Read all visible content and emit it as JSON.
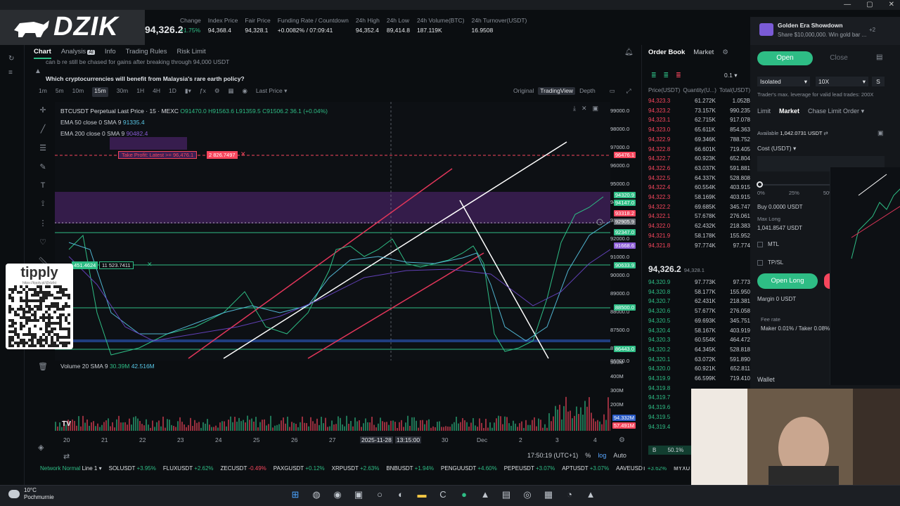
{
  "window": {
    "controls": [
      "—",
      "▢",
      "✕"
    ]
  },
  "logo": {
    "text": "DZIK"
  },
  "header": {
    "last_price": "94,326.2",
    "stats": [
      {
        "k": "Change",
        "v": "+1.75%",
        "green": true
      },
      {
        "k": "Index Price",
        "v": "94,368.4"
      },
      {
        "k": "Fair Price",
        "v": "94,328.1"
      },
      {
        "k": "Funding Rate / Countdown",
        "v": "+0.0082% / 07:09:41"
      },
      {
        "k": "24h High",
        "v": "94,352.4"
      },
      {
        "k": "24h Low",
        "v": "89,414.8"
      },
      {
        "k": "24h Volume(BTC)",
        "v": "187.119K"
      },
      {
        "k": "24h Turnover(USDT)",
        "v": "16.9508"
      }
    ]
  },
  "tabs": {
    "chart": "Chart",
    "analysis": "Analysis",
    "ai": "AI",
    "info": "Info",
    "trading_rules": "Trading Rules",
    "risk_limit": "Risk Limit"
  },
  "news": {
    "line1": "can b re still be chased for gains after breaking through 94,000 USDT",
    "line2": "Which cryptocurrencies will benefit from Malaysia's rare earth policy?"
  },
  "toolbar": {
    "intervals": [
      "1m",
      "5m",
      "10m",
      "15m",
      "30m",
      "1H",
      "4H",
      "1D"
    ],
    "selected": "15m",
    "last_price": "Last Price",
    "views": [
      "Original",
      "TradingView",
      "Depth"
    ],
    "view_selected": "TradingView"
  },
  "legend": {
    "title": "BTCUSDT Perpetual Last Price · 15 · MEXC",
    "ohlc": "O91470.0 H91563.6 L91359.5 C91506.2 36.1 (+0.04%)",
    "ema50": "EMA 50 close 0 SMA 9",
    "ema50_v": "91335.4",
    "ema200": "EMA 200 close 0 SMA 9",
    "ema200_v": "90482.4",
    "volume": "Volume 20 SMA 9",
    "vol1": "30.39M",
    "vol2": "42.516M"
  },
  "orders": {
    "tp": "Take Profit: Latest >= 96,476.1",
    "tp_qty": "2 826.7497",
    "entry": "451.4624",
    "entry_qty": "11 523.7411"
  },
  "price_axis": {
    "ticks": [
      "99000.0",
      "98000.0",
      "97000.0",
      "96000.0",
      "95000.0",
      "94000.0",
      "93000.0",
      "92000.0",
      "91000.0",
      "90000.0",
      "89000.0",
      "88000.0",
      "87500.0",
      "87000.0",
      "86000.0"
    ],
    "labels": [
      {
        "v": "96476.1",
        "c": "#f6465d"
      },
      {
        "v": "94320.9",
        "c": "#2ebd85"
      },
      {
        "v": "94147.0",
        "c": "#2ebd85"
      },
      {
        "v": "93318.2",
        "c": "#f6465d"
      },
      {
        "v": "92905.9",
        "c": "#6b6f76"
      },
      {
        "v": "92347.0",
        "c": "#2ebd85"
      },
      {
        "v": "91668.6",
        "c": "#8a5bd6"
      },
      {
        "v": "90633.9",
        "c": "#2ebd85"
      },
      {
        "v": "88500.0",
        "c": "#2ebd85"
      },
      {
        "v": "86443.0",
        "c": "#2ebd85"
      }
    ],
    "vol_ticks": [
      "500M",
      "400M",
      "300M",
      "200M"
    ],
    "vol_labels": [
      "94.332M",
      "57.491M"
    ]
  },
  "date_axis": {
    "labels": [
      "20",
      "21",
      "22",
      "23",
      "24",
      "25",
      "26",
      "27",
      "2025-11-28",
      "13:15:00",
      "30",
      "Dec",
      "2",
      "3",
      "4"
    ]
  },
  "footer": {
    "time": "17:50:19 (UTC+1)",
    "pct": "%",
    "log": "log",
    "auto": "Auto"
  },
  "ticker": {
    "network": "Network Normal",
    "line": "Line 1",
    "items": [
      {
        "s": "SOLUSDT",
        "c": "+3.95%",
        "g": true
      },
      {
        "s": "FLUXUSDT",
        "c": "+2.62%",
        "g": true
      },
      {
        "s": "ZECUSDT",
        "c": "-0.49%",
        "g": false
      },
      {
        "s": "PAXGUSDT",
        "c": "+0.12%",
        "g": true
      },
      {
        "s": "XRPUSDT",
        "c": "+2.63%",
        "g": true
      },
      {
        "s": "BNBUSDT",
        "c": "+1.94%",
        "g": true
      },
      {
        "s": "PENGUUSDT",
        "c": "+4.60%",
        "g": true
      },
      {
        "s": "PEPEUSDT",
        "c": "+3.07%",
        "g": true
      },
      {
        "s": "APTUSDT",
        "c": "+3.07%",
        "g": true
      },
      {
        "s": "AAVEUSDT",
        "c": "+3.62%",
        "g": true
      },
      {
        "s": "MYXUS",
        "c": "",
        "g": true
      }
    ]
  },
  "orderbook": {
    "tab_active": "Order Book",
    "tab_other": "Market",
    "size": "0.1",
    "head_price": "Price(USDT)",
    "head_qty": "Quantity(U...)",
    "head_total": "Total(USDT)",
    "asks": [
      [
        "94,323.3",
        "61.272K",
        "1.052B"
      ],
      [
        "94,323.2",
        "73.157K",
        "990.235"
      ],
      [
        "94,323.1",
        "62.715K",
        "917.078"
      ],
      [
        "94,323.0",
        "65.611K",
        "854.363"
      ],
      [
        "94,322.9",
        "69.346K",
        "788.752"
      ],
      [
        "94,322.8",
        "66.601K",
        "719.405"
      ],
      [
        "94,322.7",
        "60.923K",
        "652.804"
      ],
      [
        "94,322.6",
        "63.037K",
        "591.881"
      ],
      [
        "94,322.5",
        "64.337K",
        "528.808"
      ],
      [
        "94,322.4",
        "60.554K",
        "403.915"
      ],
      [
        "94,322.3",
        "58.169K",
        "403.915"
      ],
      [
        "94,322.2",
        "69.685K",
        "345.747"
      ],
      [
        "94,322.1",
        "57.678K",
        "276.061"
      ],
      [
        "94,322.0",
        "62.432K",
        "218.383"
      ],
      [
        "94,321.9",
        "58.178K",
        "155.952"
      ],
      [
        "94,321.8",
        "97.774K",
        "97.774"
      ]
    ],
    "mid": "94,326.2",
    "mid_sub": "94,328.1",
    "bids": [
      [
        "94,320.9",
        "97.773K",
        "97.773"
      ],
      [
        "94,320.8",
        "58.177K",
        "155.950"
      ],
      [
        "94,320.7",
        "62.431K",
        "218.381"
      ],
      [
        "94,320.6",
        "57.677K",
        "276.058"
      ],
      [
        "94,320.5",
        "69.693K",
        "345.751"
      ],
      [
        "94,320.4",
        "58.167K",
        "403.919"
      ],
      [
        "94,320.3",
        "60.554K",
        "464.472"
      ],
      [
        "94,320.2",
        "64.345K",
        "528.818"
      ],
      [
        "94,320.1",
        "63.072K",
        "591.890"
      ],
      [
        "94,320.0",
        "60.921K",
        "652.811"
      ],
      [
        "94,319.9",
        "66.599K",
        "719.410"
      ],
      [
        "94,319.8",
        "",
        ""
      ],
      [
        "94,319.7",
        "",
        ""
      ],
      [
        "94,319.6",
        "",
        ""
      ],
      [
        "94,319.5",
        "",
        ""
      ],
      [
        "94,319.4",
        "",
        ""
      ]
    ],
    "ratio_b": "B",
    "ratio": "50.1%"
  },
  "notif": {
    "title": "Golden Era Showdown",
    "sub": "Share $10,000,000. Win gold bar ...",
    "badge": "+2"
  },
  "trade": {
    "open": "Open",
    "close": "Close",
    "margin_mode": "Isolated",
    "leverage": "10X",
    "s": "S",
    "hint": "Trader's max. leverage for valid lead trades: 200X",
    "types": [
      "Limit",
      "Market",
      "Chase Limit Order"
    ],
    "type_active": "Market",
    "available_k": "Available",
    "available_v": "1,042.0731 USDT",
    "cost": "Cost (USDT)",
    "pcts": [
      "0%",
      "25%",
      "50%"
    ],
    "buy": "Buy 0.0000 USDT",
    "max_long_k": "Max Long",
    "max_long_v": "1,041.8547 USDT",
    "mtl": "MTL",
    "tpsl": "TP/SL",
    "open_long": "Open Long",
    "margin": "Margin 0 USDT",
    "fee_k": "Fee rate",
    "fee_v": "Maker 0.01% / Taker 0.08%",
    "wallet": "Wallet"
  },
  "taskbar": {
    "temp": "10°C",
    "weather": "Pochmurnie"
  },
  "tipply": {
    "text": "tipply",
    "url": "https://tipply.pl/@dzikt"
  }
}
